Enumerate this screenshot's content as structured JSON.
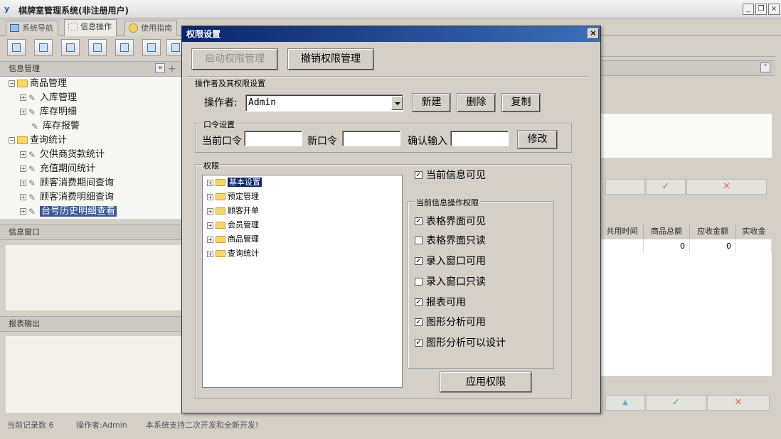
{
  "window": {
    "title": "棋牌室管理系统(非注册用户)"
  },
  "tabs": [
    {
      "label": "系统导航"
    },
    {
      "label": "信息操作"
    },
    {
      "label": "使用指南"
    }
  ],
  "left": {
    "info_header": "信息管理",
    "tree": [
      {
        "label": "商品管理",
        "type": "folder"
      },
      {
        "label": "入库管理",
        "type": "item"
      },
      {
        "label": "库存明细",
        "type": "item"
      },
      {
        "label": "库存报警",
        "type": "item"
      },
      {
        "label": "查询统计",
        "type": "folder"
      },
      {
        "label": "欠供商货款统计",
        "type": "item"
      },
      {
        "label": "充值期间统计",
        "type": "item"
      },
      {
        "label": "顾客消费期间查询",
        "type": "item"
      },
      {
        "label": "顾客消费明细查询",
        "type": "item"
      },
      {
        "label": "台号历史明细查看",
        "type": "item"
      }
    ],
    "window_header": "信息窗口",
    "report_header": "报表输出"
  },
  "right": {
    "grid_headers": [
      "共用时间",
      "商品总额",
      "应收金额",
      "实收金"
    ],
    "grid_row": [
      "",
      "0",
      "0",
      ""
    ],
    "check_icon": "✓",
    "cross_icon": "✕",
    "up_icon": "▲"
  },
  "status": {
    "records": "当前记录数 6",
    "operator": "操作者:Admin",
    "notice": "本系统支持二次开发和全新开发!"
  },
  "dialog": {
    "title": "权限设置",
    "close": "×",
    "enable_btn": "启动权限管理",
    "revoke_btn": "撤销权限管理",
    "operator_section": "操作者及其权限设置",
    "operator_label": "操作者:",
    "operator_value": "Admin",
    "new_btn": "新建",
    "delete_btn": "删除",
    "copy_btn": "复制",
    "password_section": "口令设置",
    "current_pwd_label": "当前口令",
    "new_pwd_label": "新口令",
    "confirm_label": "确认输入",
    "modify_btn": "修改",
    "perm_section": "权限",
    "perm_tree": [
      "基本设置",
      "预定管理",
      "顾客开单",
      "会员管理",
      "商品管理",
      "查询统计"
    ],
    "visible_label": "当前信息可见",
    "visible_checked": true,
    "ops_section": "当前信息操作权限",
    "ops": [
      {
        "label": "表格界面可见",
        "checked": true
      },
      {
        "label": "表格界面只读",
        "checked": false
      },
      {
        "label": "录入窗口可用",
        "checked": true
      },
      {
        "label": "录入窗口只读",
        "checked": false
      },
      {
        "label": "报表可用",
        "checked": true
      },
      {
        "label": "图形分析可用",
        "checked": true
      },
      {
        "label": "图形分析可以设计",
        "checked": true
      }
    ],
    "apply_btn": "应用权限",
    "check_mark": "✓"
  }
}
